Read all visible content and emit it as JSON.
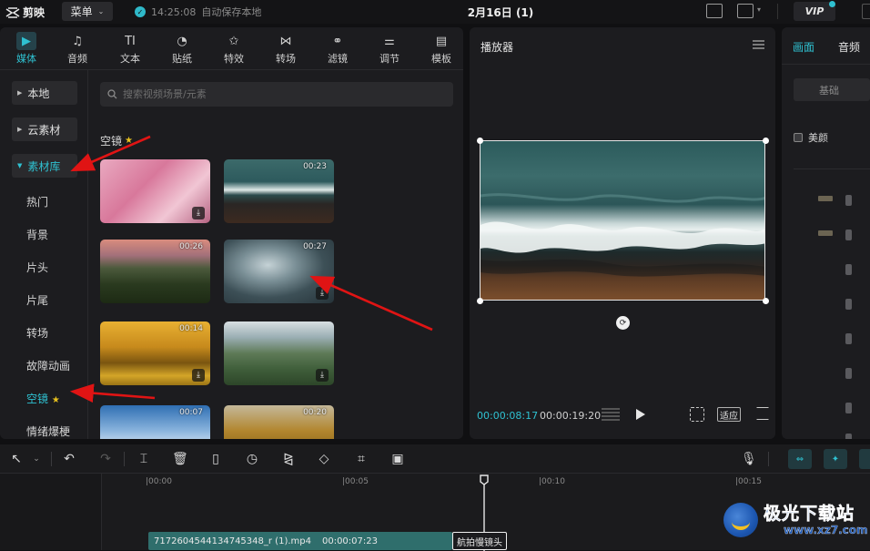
{
  "app": {
    "logo_text": "剪映",
    "menu_label": "菜单",
    "save_time": "14:25:08",
    "save_text": "自动保存本地",
    "project_title": "2月16日 (1)",
    "vip_label": "VIP"
  },
  "tool_tabs": [
    {
      "label": "媒体",
      "icon": "media-icon",
      "active": true
    },
    {
      "label": "音频",
      "icon": "audio-icon"
    },
    {
      "label": "文本",
      "icon": "text-icon"
    },
    {
      "label": "贴纸",
      "icon": "sticker-icon"
    },
    {
      "label": "特效",
      "icon": "effects-icon"
    },
    {
      "label": "转场",
      "icon": "transition-icon"
    },
    {
      "label": "滤镜",
      "icon": "filter-icon"
    },
    {
      "label": "调节",
      "icon": "adjust-icon"
    },
    {
      "label": "模板",
      "icon": "template-icon"
    }
  ],
  "sidebar": {
    "local": "本地",
    "cloud": "云素材",
    "library": "素材库",
    "items": [
      "热门",
      "背景",
      "片头",
      "片尾",
      "转场",
      "故障动画",
      "空镜",
      "情绪爆梗"
    ]
  },
  "search": {
    "placeholder": "搜索视频场景/元素"
  },
  "section": {
    "title": "空镜"
  },
  "clips": [
    {
      "duration": "",
      "scene": "cherry-blossom"
    },
    {
      "duration": "00:23",
      "scene": "ocean-shore"
    },
    {
      "duration": "00:26",
      "scene": "forest-sunset"
    },
    {
      "duration": "00:27",
      "scene": "wave"
    },
    {
      "duration": "00:14",
      "scene": "autumn-trees"
    },
    {
      "duration": "",
      "scene": "valley"
    },
    {
      "duration": "00:07",
      "scene": "sky"
    },
    {
      "duration": "00:20",
      "scene": "autumn-tree"
    }
  ],
  "player": {
    "title": "播放器",
    "current_time": "00:00:08:17",
    "total_time": "00:00:19:20",
    "fit_label": "适应"
  },
  "right_panel": {
    "tab_picture": "画面",
    "tab_audio": "音频",
    "sub_basic": "基础",
    "beauty_label": "美颜"
  },
  "timeline": {
    "ruler": [
      "|00:00",
      "|00:05",
      "|00:10",
      "|00:15"
    ],
    "clip_name": "7172604544134745348_r (1).mp4",
    "clip_duration": "00:00:07:23",
    "clip2_name": "航拍慢镜头"
  },
  "watermark": {
    "cn": "极光下载站",
    "url": "www.xz7.com"
  },
  "colors": {
    "accent": "#2fc1d1",
    "arrow": "#e01414",
    "star": "#e8c21e"
  }
}
